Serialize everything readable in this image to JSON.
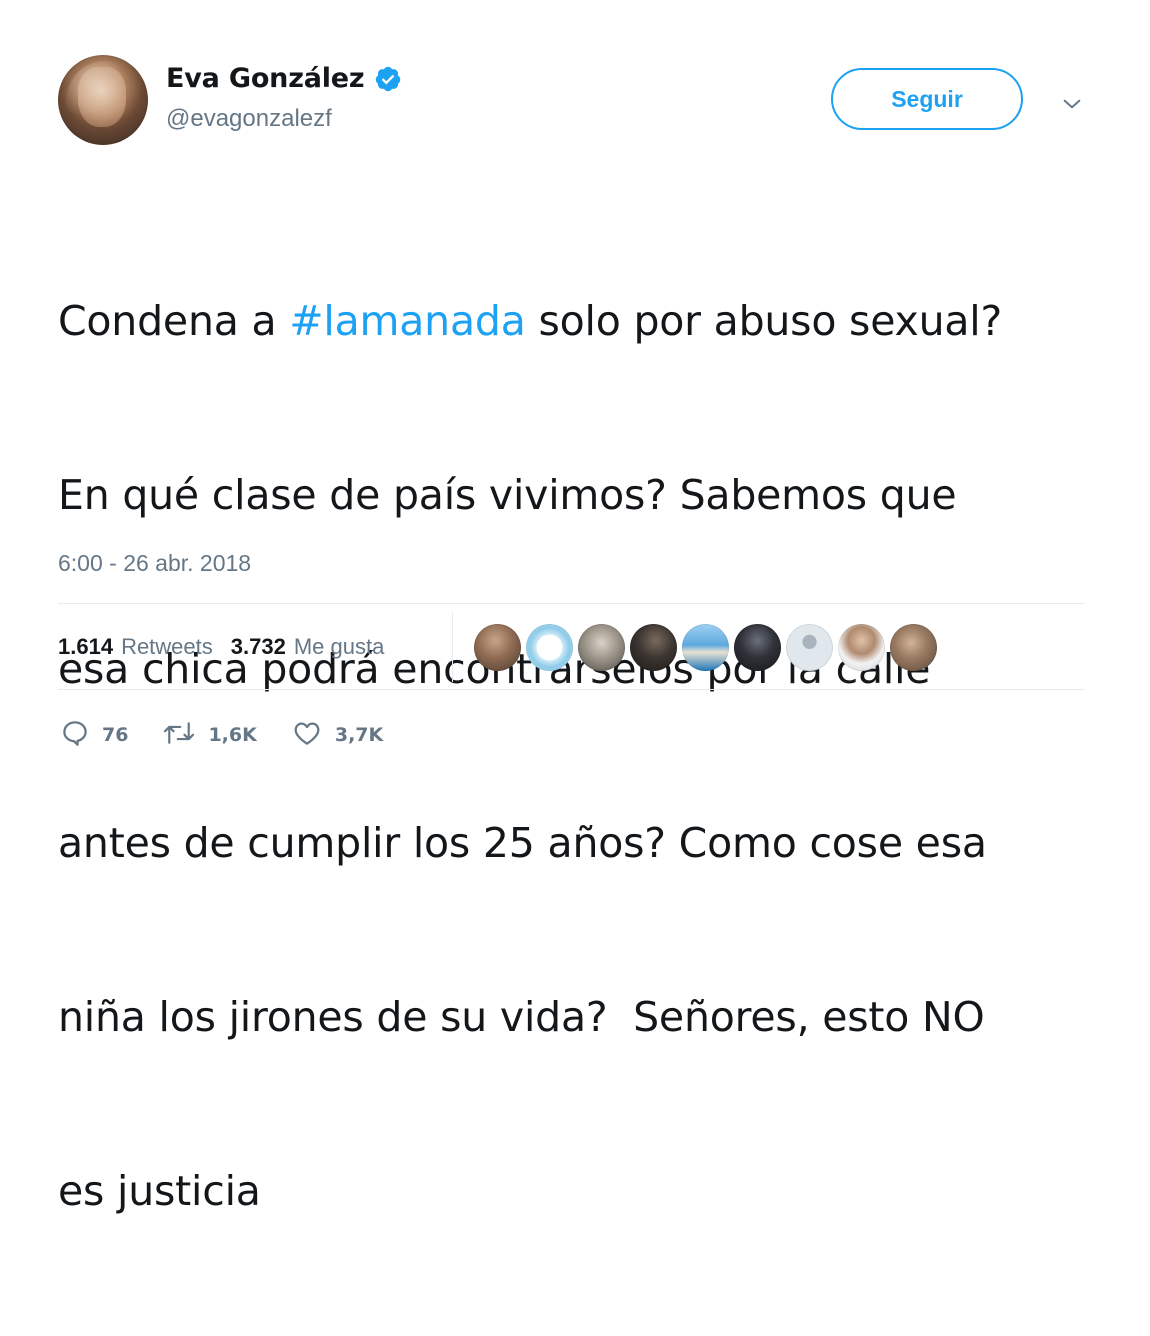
{
  "author": {
    "display_name": "Eva González",
    "handle": "@evagonzalezf",
    "avatar_icon": "profile-photo",
    "verified_icon": "verified-badge-icon"
  },
  "header": {
    "follow_label": "Seguir",
    "menu_icon": "chevron-down-icon"
  },
  "tweet": {
    "lines": [
      {
        "parts": [
          "Condena a ",
          "#lamanada",
          " solo por abuso sexual?"
        ]
      },
      {
        "parts": [
          "En qué clase de país vivimos? Sabemos que"
        ]
      },
      {
        "parts": [
          "esa chica podrá encontrárselos por la calle"
        ]
      },
      {
        "parts": [
          "antes de cumplir los 25 años? Como cose esa"
        ]
      },
      {
        "parts": [
          "niña los jirones de su vida?  Señores, esto NO"
        ]
      },
      {
        "parts": [
          "es justicia"
        ]
      }
    ],
    "timestamp": "6:00 - 26 abr. 2018"
  },
  "stats": {
    "retweets_value": "1.614",
    "retweets_label": "Retweets",
    "likes_value": "3.732",
    "likes_label": "Me gusta"
  },
  "likers": [
    {
      "name": "liker-avatar-1"
    },
    {
      "name": "liker-avatar-2"
    },
    {
      "name": "liker-avatar-3"
    },
    {
      "name": "liker-avatar-4"
    },
    {
      "name": "liker-avatar-5"
    },
    {
      "name": "liker-avatar-6"
    },
    {
      "name": "liker-avatar-7"
    },
    {
      "name": "liker-avatar-8"
    },
    {
      "name": "liker-avatar-9"
    }
  ],
  "actions": {
    "reply_count": "76",
    "retweet_count": "1,6K",
    "like_count": "3,7K",
    "reply_icon": "reply-icon",
    "retweet_icon": "retweet-icon",
    "like_icon": "heart-icon"
  },
  "colors": {
    "accent": "#1da1f2",
    "text": "#14171a",
    "secondary_text": "#657786",
    "divider": "#e6ecf0"
  }
}
